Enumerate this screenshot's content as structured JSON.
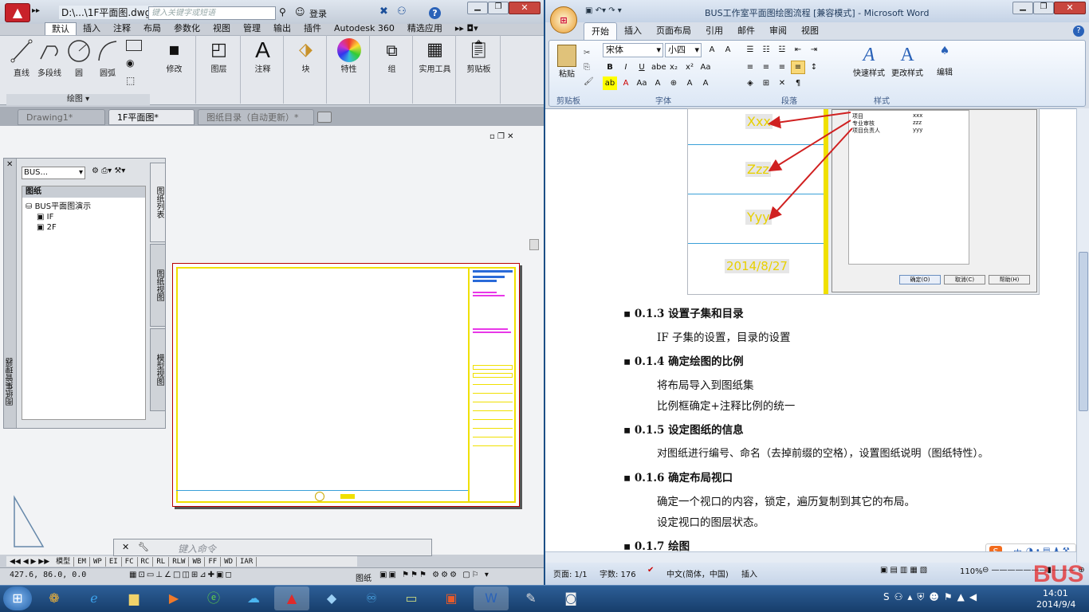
{
  "acad": {
    "title": "D:\\...\\1F平面图.dwg",
    "search_placeholder": "键入关键字或短语",
    "login": "登录",
    "help": "?",
    "tabs": [
      "默认",
      "插入",
      "注释",
      "布局",
      "参数化",
      "视图",
      "管理",
      "输出",
      "插件",
      "Autodesk 360",
      "精选应用"
    ],
    "tools_draw": [
      "直线",
      "多段线",
      "圆",
      "圆弧"
    ],
    "draw_panel": "绘图",
    "groups": [
      "修改",
      "图层",
      "注释",
      "块",
      "特性",
      "组",
      "实用工具",
      "剪贴板"
    ],
    "doc_tabs": [
      "Drawing1*",
      "1F平面图*",
      "图纸目录（自动更新）*"
    ],
    "ssm": {
      "dropdown": "BUS...",
      "section": "图纸",
      "set": "BUS平面图演示",
      "sheets": [
        "IF",
        "2F"
      ],
      "side_tabs": [
        "图纸列表",
        "图纸视图",
        "模型视图"
      ],
      "vertical_title": "图纸集管理器"
    },
    "command_placeholder": "键入命令",
    "layout_tabs": [
      "模型",
      "EM",
      "WP",
      "EI",
      "FC",
      "RC",
      "RL",
      "RLW",
      "WB",
      "FF",
      "WD",
      "IAR"
    ],
    "coords": "427.6, 86.0, 0.0",
    "status_paper": "图纸",
    "colors": {
      "yellow": "#f0e000",
      "magenta": "#e838e8",
      "blue": "#2a6ad8",
      "border": "#b80000"
    }
  },
  "word": {
    "title": "BUS工作室平面图绘图流程 [兼容模式] - Microsoft Word",
    "tabs": [
      "开始",
      "插入",
      "页面布局",
      "引用",
      "邮件",
      "审阅",
      "视图"
    ],
    "paste": "粘贴",
    "font": "宋体",
    "size": "小四",
    "style1": "快速样式",
    "style2": "更改样式",
    "edit": "编辑",
    "groups": [
      "剪贴板",
      "字体",
      "段落",
      "样式"
    ],
    "image": {
      "labels": [
        "Xxx",
        "Zzz",
        "Yyy",
        "2014/8/27"
      ],
      "dialog_rows": [
        "项目",
        "专业审核",
        "项目负责人"
      ],
      "dialog_vals": [
        "xxx",
        "zzz",
        "yyy"
      ],
      "buttons": [
        "确定(O)",
        "取消(C)",
        "帮助(H)"
      ]
    },
    "paragraphs": [
      {
        "text": "0.1.3 设置子集和目录",
        "h": true
      },
      {
        "text": "IF 子集的设置，目录的设置",
        "h": false
      },
      {
        "text": "0.1.4 确定绘图的比例",
        "h": true
      },
      {
        "text": "将布局导入到图纸集",
        "h": false
      },
      {
        "text": "比例框确定+注释比例的统一",
        "h": false
      },
      {
        "text": "0.1.5 设定图纸的信息",
        "h": true
      },
      {
        "text": "对图纸进行编号、命名（去掉前缀的空格），设置图纸说明（图纸特性）。",
        "h": false
      },
      {
        "text": "0.1.6 确定布局视口",
        "h": true
      },
      {
        "text": "确定一个视口的内容，锁定，遍历复制到其它的布局。",
        "h": false
      },
      {
        "text": "设定视口的图层状态。",
        "h": false
      },
      {
        "text": "0.1.7 绘图",
        "h": true
      }
    ],
    "status": {
      "page": "页面: 1/1",
      "words": "字数: 176",
      "lang": "中文(简体，中国)",
      "mode": "插入",
      "zoom": "110%"
    },
    "ime": "中"
  },
  "taskbar": {
    "time": "14:01",
    "date": "2014/9/4",
    "brand": "BUS"
  }
}
